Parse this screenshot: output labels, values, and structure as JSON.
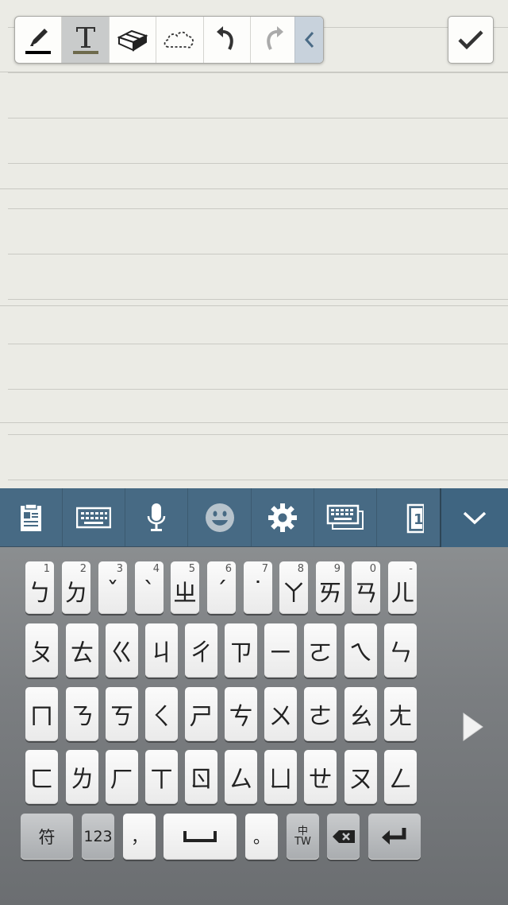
{
  "pen_toolbar": {
    "tools": [
      {
        "name": "pen",
        "icon": "pen-icon",
        "selected": false
      },
      {
        "name": "text",
        "icon": "text-icon",
        "selected": true
      },
      {
        "name": "eraser",
        "icon": "eraser-icon",
        "selected": false
      },
      {
        "name": "selection",
        "icon": "lasso-cloud-icon",
        "selected": false
      },
      {
        "name": "undo",
        "icon": "undo-icon",
        "selected": false
      },
      {
        "name": "redo",
        "icon": "redo-icon",
        "selected": false
      },
      {
        "name": "collapse",
        "icon": "chevron-left-icon",
        "selected": false
      }
    ],
    "pen_color": "#000000",
    "text_color": "#6d6a4c"
  },
  "confirm": {
    "icon": "checkmark-icon"
  },
  "keyboard_toolbar": {
    "items": [
      "clipboard-icon",
      "keyboard-icon",
      "microphone-icon",
      "emoji-icon",
      "settings-gear-icon",
      "keyboard-layout-icon",
      "one-handed-icon"
    ],
    "hide_icon": "chevron-down-icon",
    "accent": "#476a84"
  },
  "keyboard": {
    "row1": [
      {
        "main": "ㄅ",
        "hint": "1"
      },
      {
        "main": "ㄉ",
        "hint": "2"
      },
      {
        "main": "ˇ",
        "hint": "3"
      },
      {
        "main": "ˋ",
        "hint": "4"
      },
      {
        "main": "ㄓ",
        "hint": "5"
      },
      {
        "main": "ˊ",
        "hint": "6"
      },
      {
        "main": "˙",
        "hint": "7"
      },
      {
        "main": "ㄚ",
        "hint": "8"
      },
      {
        "main": "ㄞ",
        "hint": "9"
      },
      {
        "main": "ㄢ",
        "hint": "0"
      },
      {
        "main": "ㄦ",
        "hint": "-"
      }
    ],
    "row2": [
      "ㄆ",
      "ㄊ",
      "ㄍ",
      "ㄐ",
      "ㄔ",
      "ㄗ",
      "ㄧ",
      "ㄛ",
      "ㄟ",
      "ㄣ"
    ],
    "row3": [
      "ㄇ",
      "ㄋ",
      "ㄎ",
      "ㄑ",
      "ㄕ",
      "ㄘ",
      "ㄨ",
      "ㄜ",
      "ㄠ",
      "ㄤ"
    ],
    "row4": [
      "ㄈ",
      "ㄌ",
      "ㄏ",
      "ㄒ",
      "ㄖ",
      "ㄙ",
      "ㄩ",
      "ㄝ",
      "ㄡ",
      "ㄥ"
    ],
    "bottom": {
      "symbols": "符",
      "numbers": "123",
      "comma": "，",
      "period": "。",
      "lang_top": "中",
      "lang_bottom": "TW"
    },
    "next_page_icon": "triangle-right-icon"
  }
}
